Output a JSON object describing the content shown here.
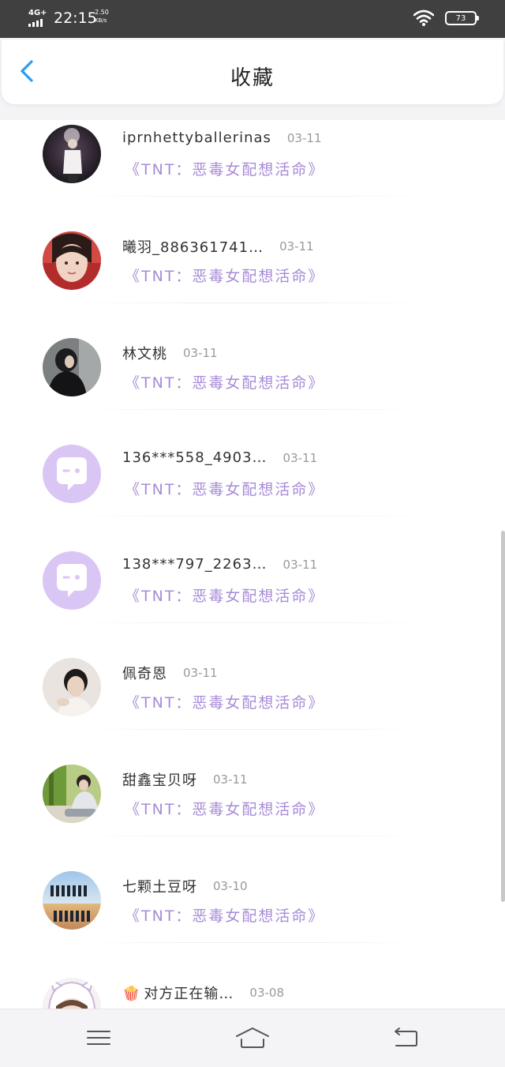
{
  "status_bar": {
    "network": "4G+",
    "time": "22:15",
    "speed_value": "2.50",
    "speed_unit": "KB/s",
    "battery": "73",
    "icons": [
      "signal-icon",
      "wifi-icon",
      "battery-icon"
    ]
  },
  "header": {
    "back_icon": "chevron-left-icon",
    "title": "收藏"
  },
  "items": [
    {
      "name": "iprnhettyballerinas",
      "date": "03-11",
      "book": "《TNT：恶毒女配想活命》",
      "avatar": "photo"
    },
    {
      "name": "曦羽_886361741…",
      "date": "03-11",
      "book": "《TNT：恶毒女配想活命》",
      "avatar": "photo"
    },
    {
      "name": "林文桃",
      "date": "03-11",
      "book": "《TNT：恶毒女配想活命》",
      "avatar": "photo"
    },
    {
      "name": "136***558_4903…",
      "date": "03-11",
      "book": "《TNT：恶毒女配想活命》",
      "avatar": "default-chat-icon"
    },
    {
      "name": "138***797_2263…",
      "date": "03-11",
      "book": "《TNT：恶毒女配想活命》",
      "avatar": "default-chat-icon"
    },
    {
      "name": "佩奇恩",
      "date": "03-11",
      "book": "《TNT：恶毒女配想活命》",
      "avatar": "photo"
    },
    {
      "name": "甜鑫宝贝呀",
      "date": "03-11",
      "book": "《TNT：恶毒女配想活命》",
      "avatar": "photo"
    },
    {
      "name": "七颗土豆呀",
      "date": "03-10",
      "book": "《TNT：恶毒女配想活命》",
      "avatar": "photo"
    },
    {
      "name": "对方正在输…",
      "name_emoji": "🍿",
      "date": "03-08",
      "book": "",
      "avatar": "photo"
    }
  ],
  "colors": {
    "status_bar": "#404040",
    "accent_blue": "#2a9df4",
    "book_purple": "#a78bd8",
    "default_avatar_bg": "#d9c6f5"
  },
  "navbar": {
    "icons": [
      "menu-icon",
      "home-icon",
      "back-icon"
    ]
  }
}
